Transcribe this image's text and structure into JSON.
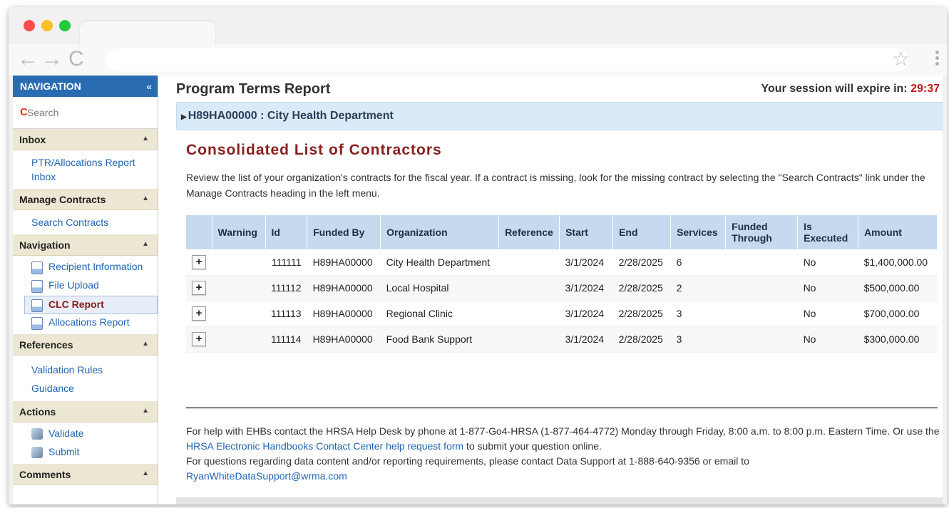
{
  "browser": {
    "back_icon": "←",
    "forward_icon": "→",
    "reload_icon": "C",
    "star_icon": "☆"
  },
  "sidebar": {
    "header": "NAVIGATION",
    "collapse_icon": "«",
    "search_placeholder": "Search",
    "sections": {
      "inbox": {
        "title": "Inbox",
        "items": [
          "PTR/Allocations Report Inbox"
        ]
      },
      "manage": {
        "title": "Manage Contracts",
        "items": [
          "Search Contracts"
        ]
      },
      "navigation": {
        "title": "Navigation",
        "items": [
          "Recipient Information",
          "File Upload",
          "CLC Report",
          "Allocations Report"
        ]
      },
      "references": {
        "title": "References",
        "items": [
          "Validation Rules",
          "Guidance"
        ]
      },
      "actions": {
        "title": "Actions",
        "items": [
          "Validate",
          "Submit"
        ]
      },
      "comments": {
        "title": "Comments"
      }
    }
  },
  "main": {
    "title": "Program Terms Report",
    "session_label": "Your session will expire in:",
    "session_timer": "29:37",
    "org": "H89HA00000 : City Health Department",
    "section_title": "Consolidated List of Contractors",
    "description": "Review the list of your organization's contracts for the fiscal year. If a contract is missing, look for the missing contract by selecting the \"Search Contracts\" link under the Manage Contracts heading in the left menu.",
    "table": {
      "columns": [
        "",
        "Warning",
        "Id",
        "Funded By",
        "Organization",
        "Reference",
        "Start",
        "End",
        "Services",
        "Funded Through",
        "Is Executed",
        "Amount"
      ],
      "expand_label": "+",
      "rows": [
        {
          "warning": "",
          "id": "111111",
          "funded_by": "H89HA00000",
          "organization": "City Health Department",
          "reference": "",
          "start": "3/1/2024",
          "end": "2/28/2025",
          "services": "6",
          "funded_through": "",
          "executed": "No",
          "amount": "$1,400,000.00"
        },
        {
          "warning": "",
          "id": "111112",
          "funded_by": "H89HA00000",
          "organization": "Local Hospital",
          "reference": "",
          "start": "3/1/2024",
          "end": "2/28/2025",
          "services": "2",
          "funded_through": "",
          "executed": "No",
          "amount": "$500,000.00"
        },
        {
          "warning": "",
          "id": "111113",
          "funded_by": "H89HA00000",
          "organization": "Regional Clinic",
          "reference": "",
          "start": "3/1/2024",
          "end": "2/28/2025",
          "services": "3",
          "funded_through": "",
          "executed": "No",
          "amount": "$700,000.00"
        },
        {
          "warning": "",
          "id": "111114",
          "funded_by": "H89HA00000",
          "organization": "Food Bank Support",
          "reference": "",
          "start": "3/1/2024",
          "end": "2/28/2025",
          "services": "3",
          "funded_through": "",
          "executed": "No",
          "amount": "$300,000.00"
        }
      ]
    },
    "footer": {
      "line1_pre": "For help with EHBs contact the HRSA Help Desk by phone at 1-877-Go4-HRSA (1-877-464-4772) Monday through Friday, 8:00 a.m. to 8:00 p.m. Eastern Time. Or use the ",
      "line1_link": "HRSA Electronic Handbooks Contact Center help request form",
      "line1_post": " to submit your question online.",
      "line2": "For questions regarding data content and/or reporting requirements, please contact Data Support at 1-888-640-9356 or email to",
      "email": "RyanWhiteDataSupport@wrma.com"
    }
  },
  "colors": {
    "nav_header": "#2a6cb2",
    "section_header": "#ebe7d2",
    "link": "#1f64b5",
    "title_red": "#8b1e1e",
    "timer_red": "#c4161c",
    "org_bar": "#d9eaf9",
    "table_header": "#c6d9ee"
  }
}
